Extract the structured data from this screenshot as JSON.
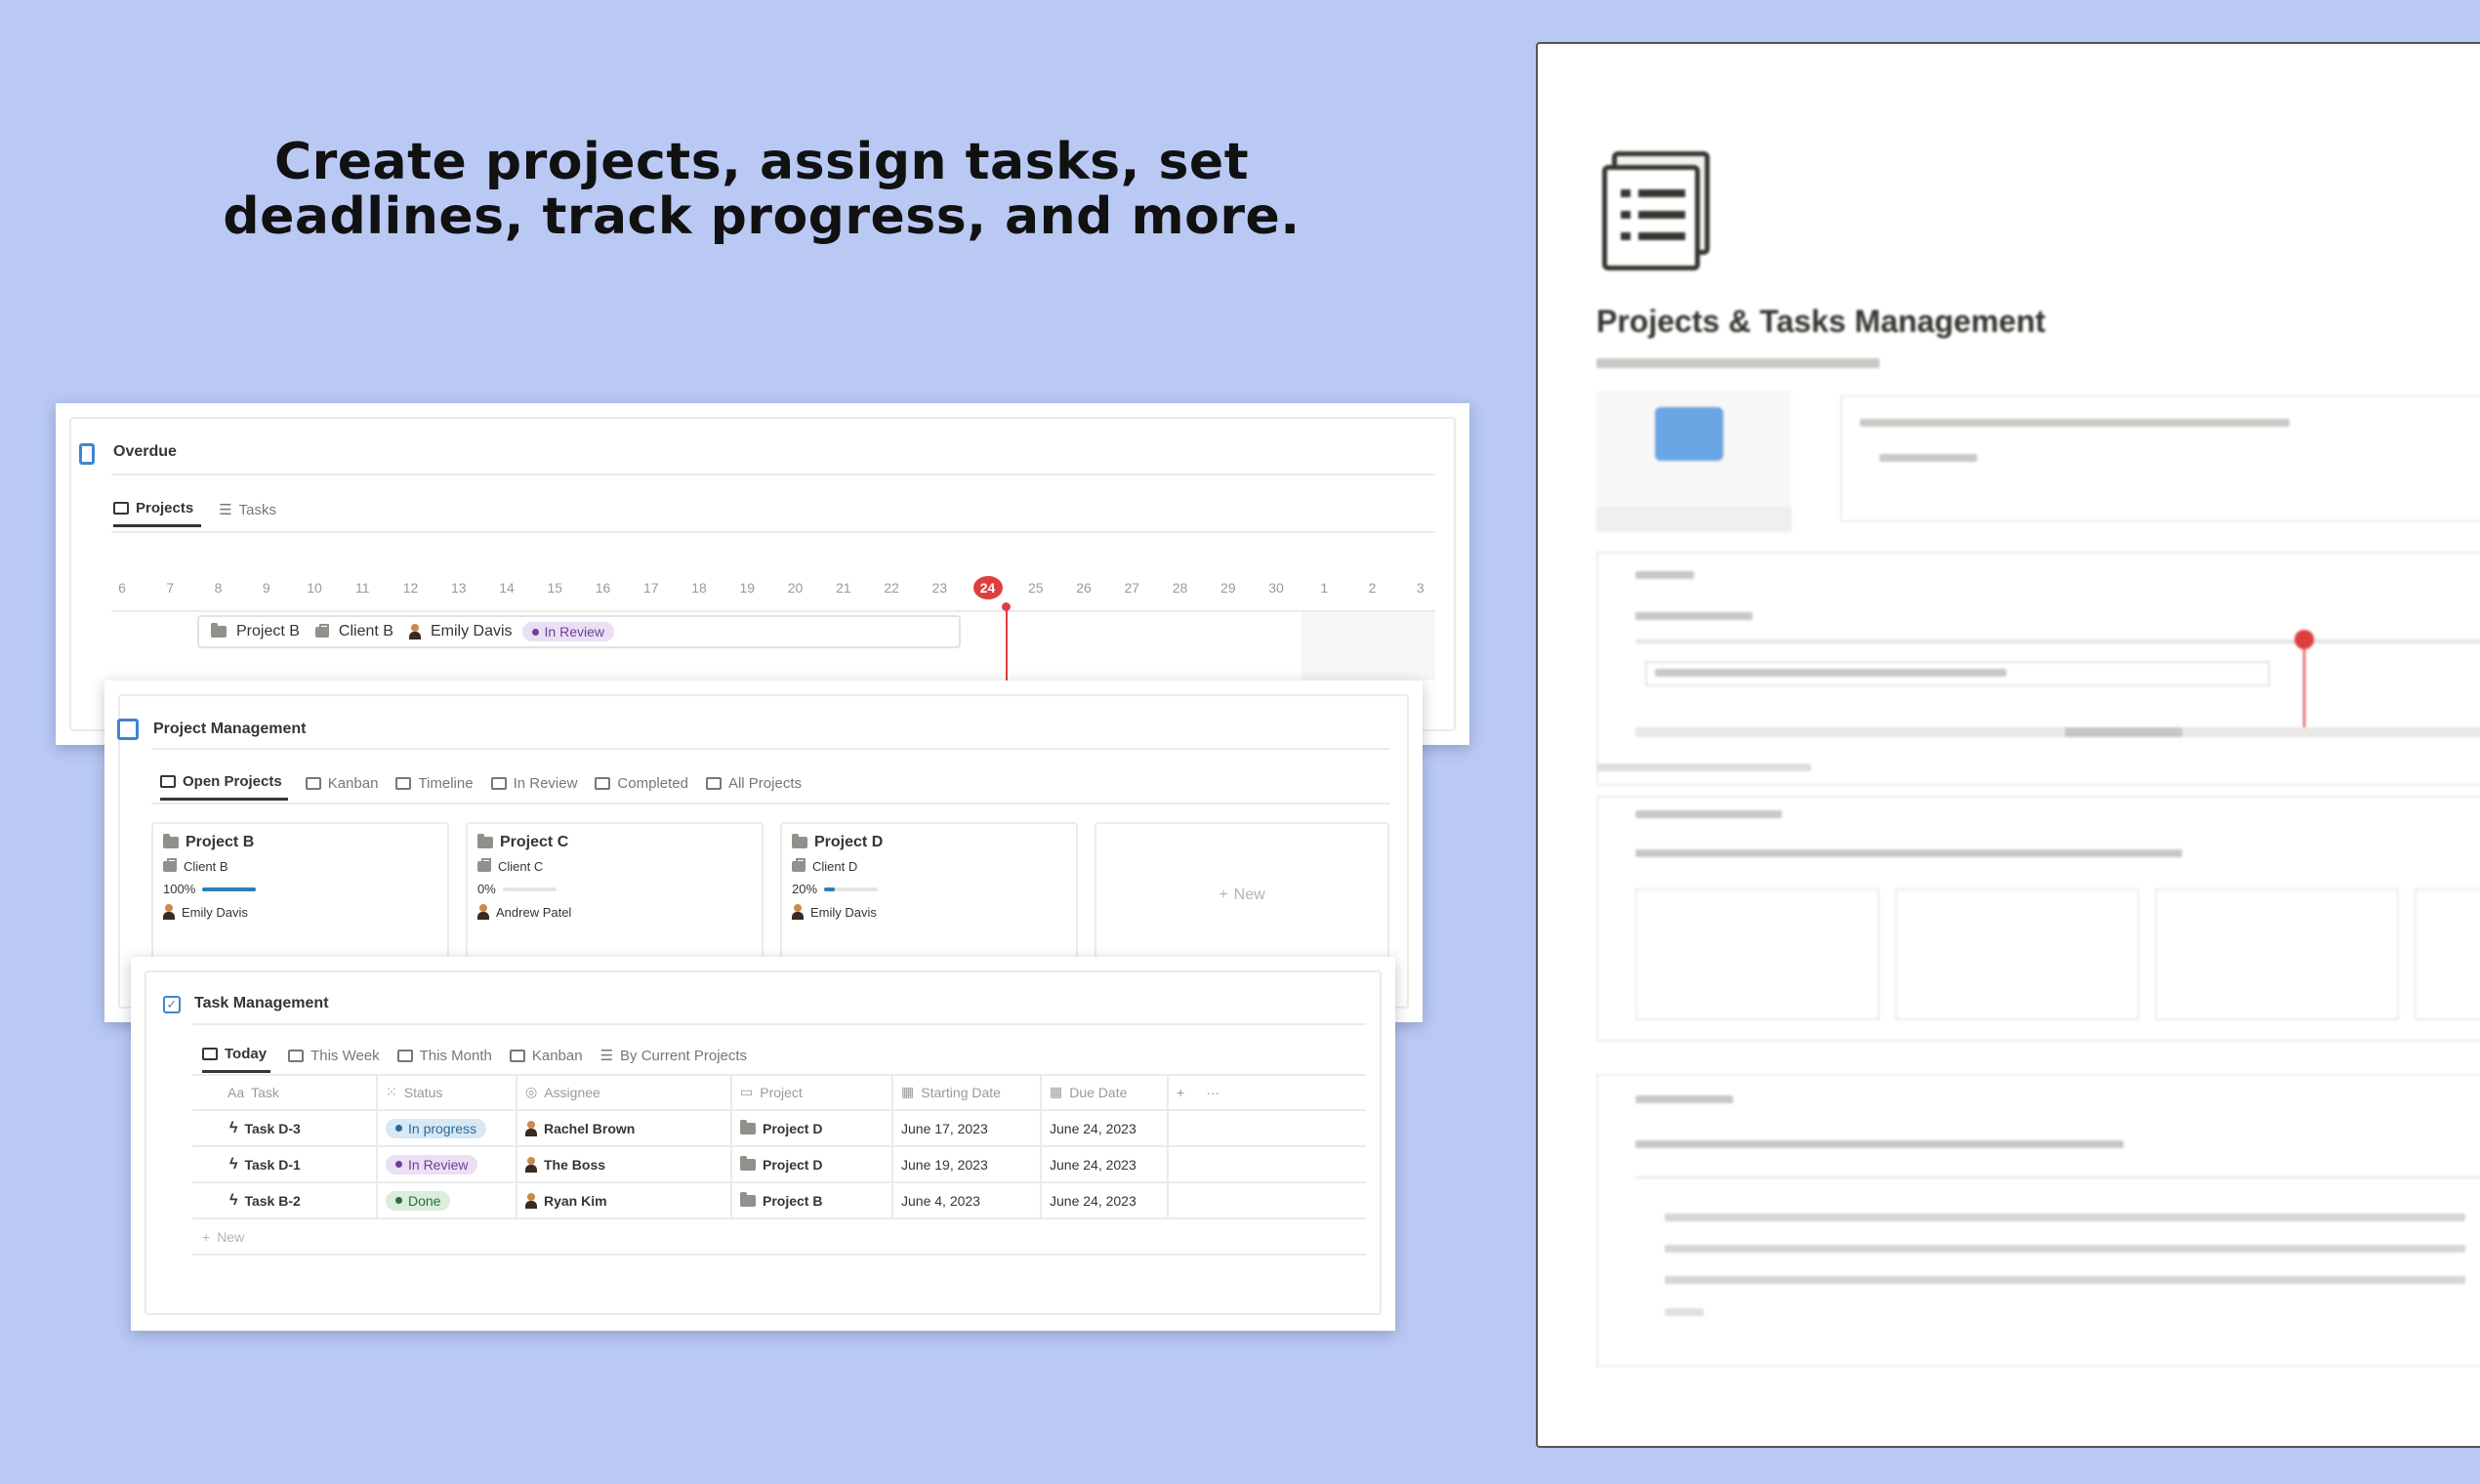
{
  "headline": {
    "line1": "Create projects, assign tasks, set",
    "line2": "deadlines, track progress, and more."
  },
  "overdue": {
    "title": "Overdue",
    "tabs": [
      "Projects",
      "Tasks"
    ],
    "days": [
      "6",
      "7",
      "8",
      "9",
      "10",
      "11",
      "12",
      "13",
      "14",
      "15",
      "16",
      "17",
      "18",
      "19",
      "20",
      "21",
      "22",
      "23",
      "24",
      "25",
      "26",
      "27",
      "28",
      "29",
      "30",
      "1",
      "2",
      "3"
    ],
    "today": "24",
    "bar": {
      "project": "Project B",
      "client": "Client B",
      "person": "Emily Davis",
      "status": "In Review"
    }
  },
  "project_mgmt": {
    "title": "Project Management",
    "tabs": [
      "Open Projects",
      "Kanban",
      "Timeline",
      "In Review",
      "Completed",
      "All Projects"
    ],
    "cards": [
      {
        "name": "Project B",
        "client": "Client B",
        "progress": "100%",
        "progress_value": 1.0,
        "person": "Emily Davis"
      },
      {
        "name": "Project C",
        "client": "Client C",
        "progress": "0%",
        "progress_value": 0.0,
        "person": "Andrew Patel"
      },
      {
        "name": "Project D",
        "client": "Client D",
        "progress": "20%",
        "progress_value": 0.2,
        "person": "Emily Davis"
      }
    ],
    "new_label": "New"
  },
  "task_mgmt": {
    "title": "Task Management",
    "tabs": [
      "Today",
      "This Week",
      "This Month",
      "Kanban",
      "By Current Projects"
    ],
    "columns": [
      "Task",
      "Status",
      "Assignee",
      "Project",
      "Starting Date",
      "Due Date"
    ],
    "col_prefix_task": "Aa",
    "rows": [
      {
        "task": "Task D-3",
        "status": "In progress",
        "assignee": "Rachel Brown",
        "project": "Project D",
        "start": "June 17, 2023",
        "due": "June 24, 2023"
      },
      {
        "task": "Task D-1",
        "status": "In Review",
        "assignee": "The Boss",
        "project": "Project D",
        "start": "June 19, 2023",
        "due": "June 24, 2023"
      },
      {
        "task": "Task B-2",
        "status": "Done",
        "assignee": "Ryan Kim",
        "project": "Project B",
        "start": "June 4, 2023",
        "due": "June 24, 2023"
      }
    ],
    "new_label": "New"
  },
  "right_page": {
    "title": "Projects & Tasks Management"
  }
}
